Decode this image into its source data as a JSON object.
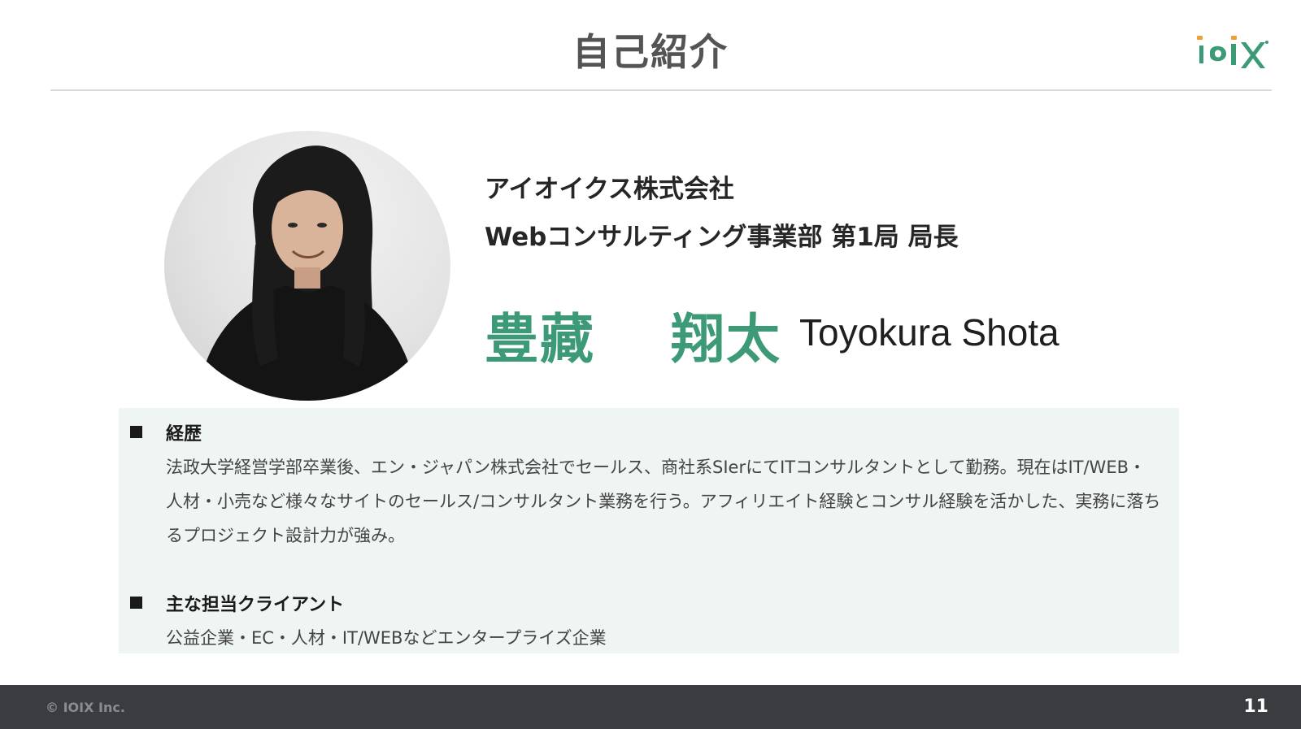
{
  "slide": {
    "title": "自己紹介"
  },
  "profile": {
    "company": "アイオイクス株式会社",
    "role": "Webコンサルティング事業部 第1局 局長",
    "name_jp": "豊藏　 翔太",
    "name_en": "Toyokura Shota"
  },
  "sections": [
    {
      "heading": "経歴",
      "body": "法政大学経営学部卒業後、エン・ジャパン株式会社でセールス、商社系SIerにてITコンサルタントとして勤務。現在はIT/WEB・人材・小売など様々なサイトのセールス/コンサルタント業務を行う。アフィリエイト経験とコンサル経験を活かした、実務に落ちるプロジェクト設計力が強み。"
    },
    {
      "heading": "主な担当クライアント",
      "body": "公益企業・EC・人材・IT/WEBなどエンタープライズ企業"
    }
  ],
  "footer": {
    "copyright": "© IOIX Inc.",
    "page": "11"
  },
  "colors": {
    "accent": "#3d9a77",
    "logo_orange": "#f0a032",
    "footer_bg": "#3a3c40",
    "box_bg": "#eef5f2"
  },
  "icons": {
    "logo": "ioix-logo",
    "bullet": "square-bullet-icon"
  }
}
